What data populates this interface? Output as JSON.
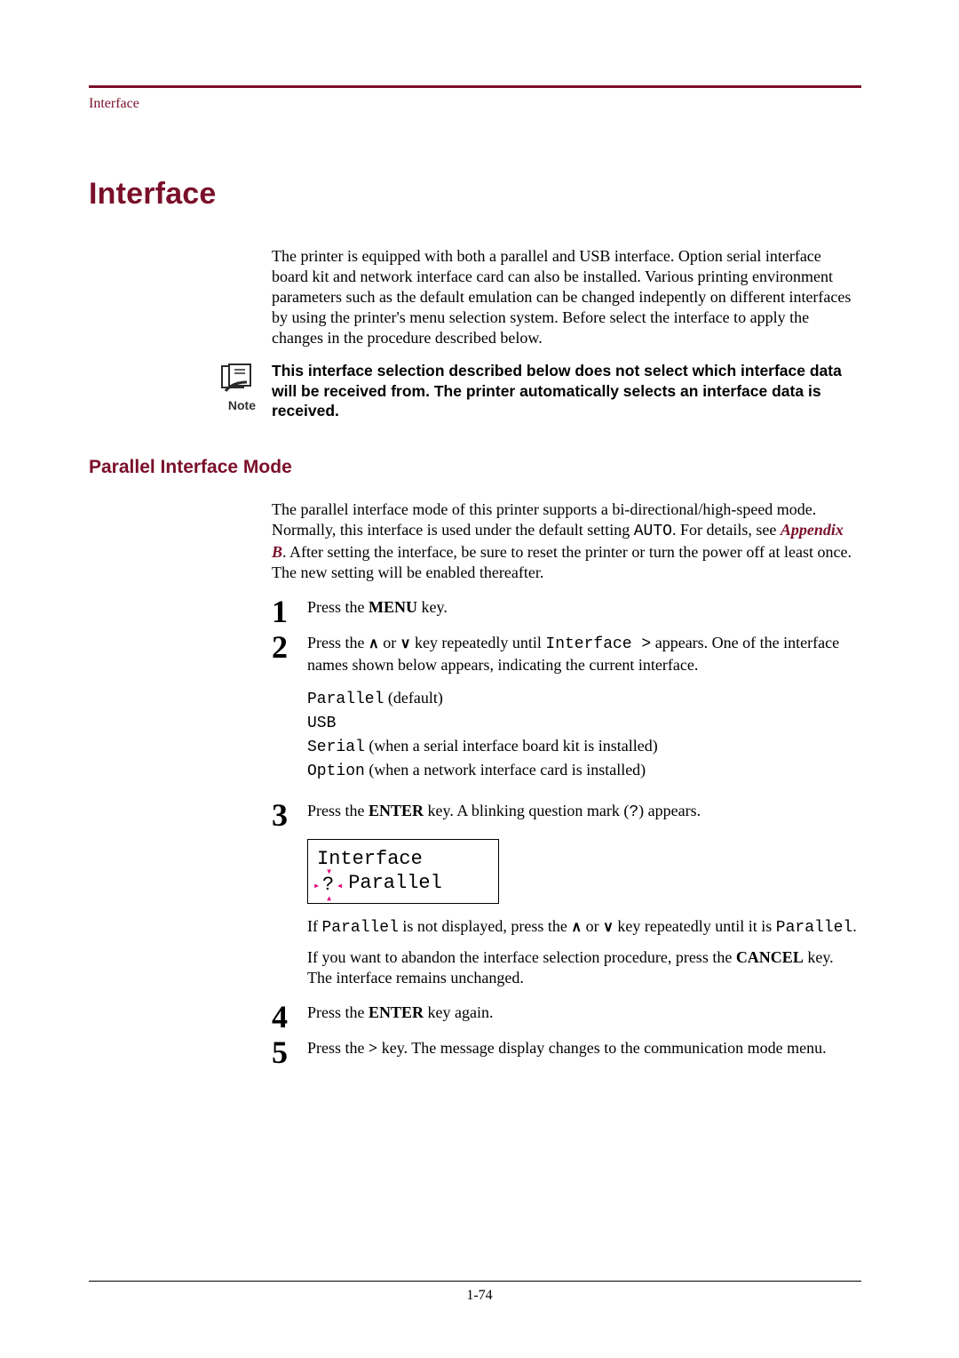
{
  "running_head": "Interface",
  "section_title": "Interface",
  "intro": "The printer is equipped with both a parallel and USB interface. Option serial interface board kit and network interface card can also be installed. Various printing environment parameters such as the default emulation can be changed indepently on different interfaces by using the printer's menu selection system. Before select the interface to apply the changes in the procedure described below.",
  "note_label": "Note",
  "note_text": "This interface selection described below does not select which interface data will be received from. The printer automatically selects an interface data is received.",
  "sub_title": "Parallel Interface Mode",
  "parallel_intro_a": "The parallel interface mode of this printer supports a bi-directional/high-speed mode. Normally, this interface is used under the default setting ",
  "parallel_intro_auto": "AUTO",
  "parallel_intro_b": ". For details, see ",
  "appendix_link": "Appendix B",
  "parallel_intro_c": ". After setting the interface, be sure to reset the printer or turn the power off at least once. The new setting will be enabled thereafter.",
  "steps": {
    "s1": {
      "pre": "Press the ",
      "key": "MENU",
      "post": " key."
    },
    "s2": {
      "pre": "Press the ",
      "mid": " key repeatedly until ",
      "code": "Interface >",
      "post": " appears. One of the interface names shown below appears, indicating the current interface."
    },
    "options": {
      "o1_code": "Parallel",
      "o1_label": " (default)",
      "o2_code": "USB",
      "o3_code": "Serial",
      "o3_label": " (when a serial interface board kit is installed)",
      "o4_code": "Option",
      "o4_label": " (when a network interface card is installed)"
    },
    "s3": {
      "pre": "Press the ",
      "key": "ENTER",
      "mid": " key. A blinking question mark (",
      "q": "?",
      "post": ") appears."
    },
    "lcd": {
      "line1": "Interface",
      "q": "?",
      "line2": "Parallel"
    },
    "s3b_pre": "If ",
    "s3b_code1": "Parallel",
    "s3b_mid": " is not displayed, press the ",
    "s3b_mid2": " key repeatedly until it is ",
    "s3b_code2": "Parallel",
    "s3b_end": ".",
    "s3c_pre": "If you want to abandon the interface selection procedure, press the ",
    "s3c_key": "CANCEL",
    "s3c_post": " key. The interface remains unchanged.",
    "s4": {
      "pre": "Press the ",
      "key": "ENTER",
      "post": " key again."
    },
    "s5": {
      "pre": "Press the ",
      "key": ">",
      "post": " key. The message display changes to the communication mode menu."
    }
  },
  "up_arrow": "∧",
  "down_arrow": "∨",
  "or_word": " or ",
  "page_num": "1-74"
}
